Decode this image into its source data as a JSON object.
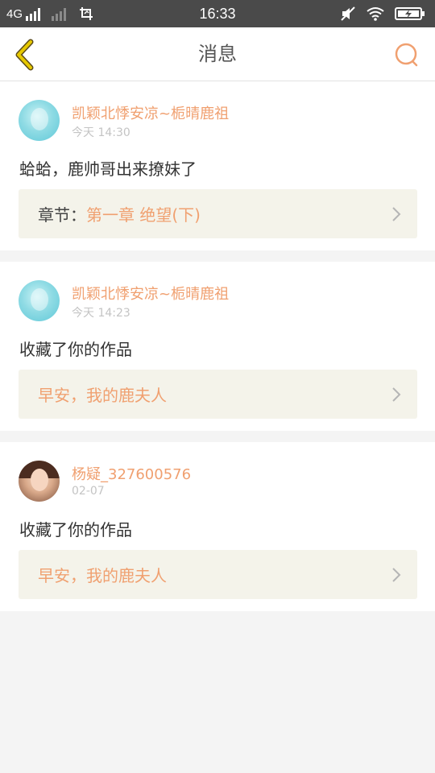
{
  "status_bar": {
    "network": "4G",
    "time": "16:33",
    "icons": [
      "signal-icon",
      "signal-weak-icon",
      "screenshot-icon",
      "mute-icon",
      "wifi-icon",
      "battery-charging-icon"
    ]
  },
  "header": {
    "title": "消息",
    "back_icon": "back-chevron-icon",
    "search_icon": "search-icon"
  },
  "messages": [
    {
      "username": "凯颖北悸安凉~栀晴鹿祖",
      "time": "今天 14:30",
      "text": "蛤蛤，鹿帅哥出来撩妹了",
      "ref_label": "章节：",
      "ref_value": "第一章  绝望(下)"
    },
    {
      "username": "凯颖北悸安凉~栀晴鹿祖",
      "time": "今天 14:23",
      "text": "收藏了你的作品",
      "ref_label": "",
      "ref_value": "早安，我的鹿夫人"
    },
    {
      "username": "杨疑_327600576",
      "time": "02-07",
      "text": "收藏了你的作品",
      "ref_label": "",
      "ref_value": "早安，我的鹿夫人"
    }
  ],
  "colors": {
    "accent": "#f0a070",
    "status_bar": "#4a4a4a",
    "back_arrow": "#e6c800",
    "ref_background": "#f4f3ea",
    "page_background": "#f4f4f4"
  }
}
